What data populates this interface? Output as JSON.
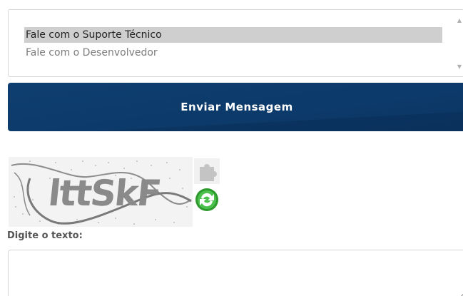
{
  "contact_select": {
    "options": [
      "Fale com o Suporte Técnico",
      "Fale com o Desenvolvedor"
    ],
    "selected_option": "Fale com o Suporte Técnico",
    "selected_background": "#cfcfcf"
  },
  "send_button": {
    "label": "Enviar Mensagem",
    "color": "#0d3b6b"
  },
  "captcha": {
    "image_text": "lttSkF",
    "audio_icon": "puzzle-icon",
    "refresh_icon": "refresh-icon"
  },
  "captcha_field": {
    "label": "Digite o texto:",
    "value": ""
  }
}
